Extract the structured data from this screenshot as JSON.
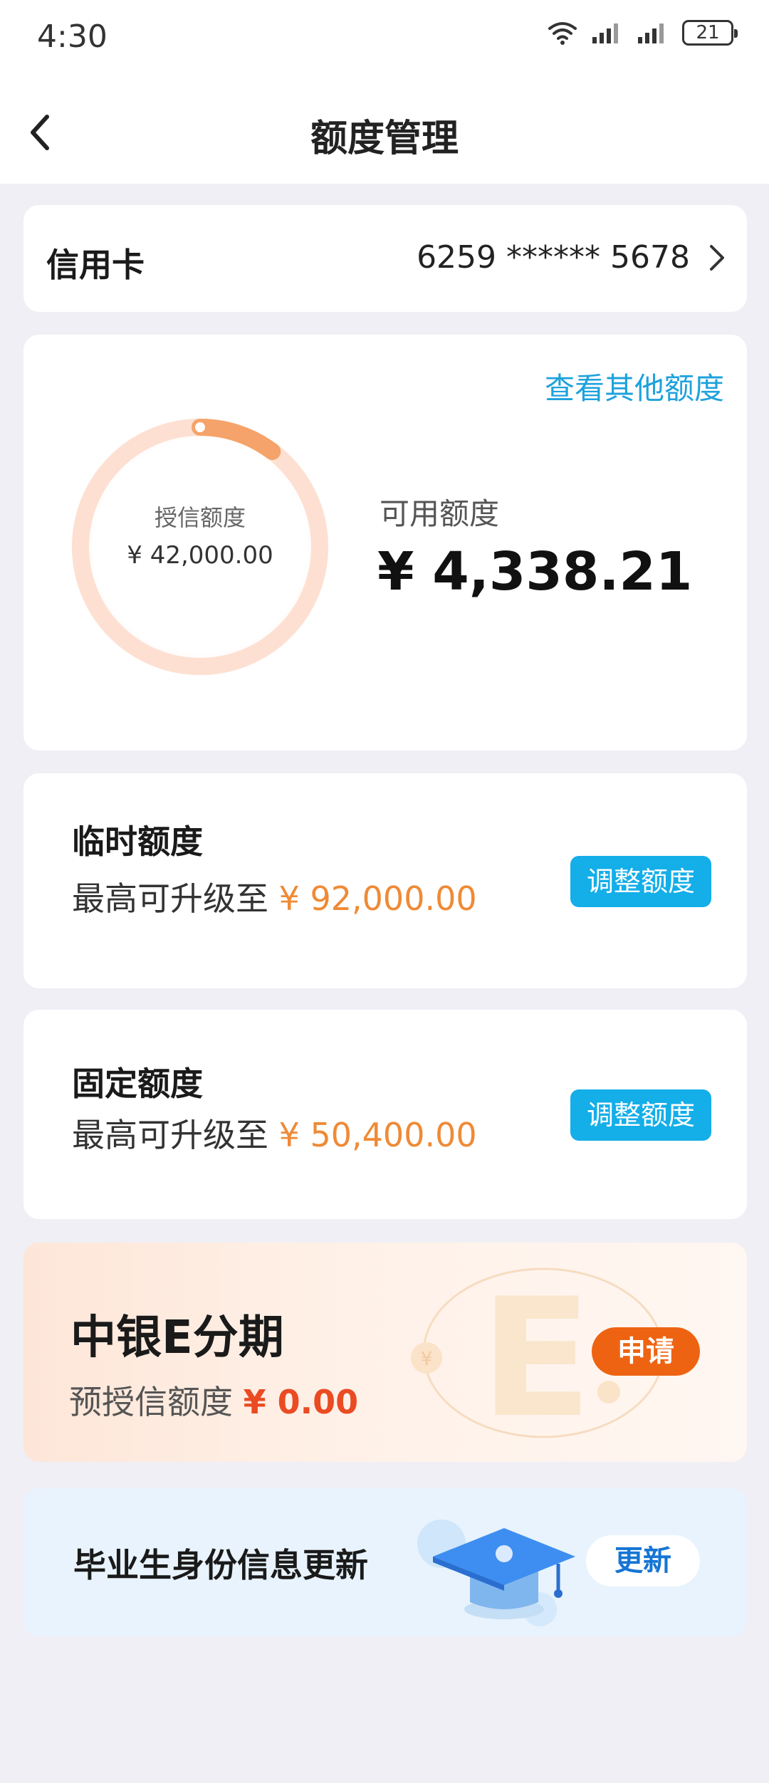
{
  "status_bar": {
    "time": "4:30",
    "battery": "21",
    "icons": [
      "wifi-icon",
      "signal-icon",
      "signal-icon",
      "battery-icon"
    ]
  },
  "nav": {
    "title": "额度管理",
    "back_icon": "chevron-left-icon"
  },
  "card_selector": {
    "label": "信用卡",
    "number": "6259 ****** 5678"
  },
  "limit_overview": {
    "other_limits_link": "查看其他额度",
    "credit_label": "授信额度",
    "credit_value": "¥ 42,000.00",
    "available_label": "可用额度",
    "available_value": "¥ 4,338.21",
    "available_ratio": 0.103
  },
  "temporary_limit": {
    "title": "临时额度",
    "subtitle": "最高可升级至",
    "amount": "¥ 92,000.00",
    "button": "调整额度"
  },
  "fixed_limit": {
    "title": "固定额度",
    "subtitle": "最高可升级至",
    "amount": "¥ 50,400.00",
    "button": "调整额度"
  },
  "e_installment": {
    "title": "中银E分期",
    "subtitle": "预授信额度",
    "amount": "¥ 0.00",
    "button": "申请"
  },
  "graduate_update": {
    "title": "毕业生身份信息更新",
    "button": "更新"
  },
  "colors": {
    "accent_blue": "#14aee8",
    "link_blue": "#1ea2dc",
    "orange_amount": "#ef8a36",
    "red_amount": "#ea4b22",
    "apply_orange": "#ee6312",
    "ring_track": "#fde0d2",
    "ring_arc": "#f5a36a",
    "page_bg": "#f0eff5"
  }
}
